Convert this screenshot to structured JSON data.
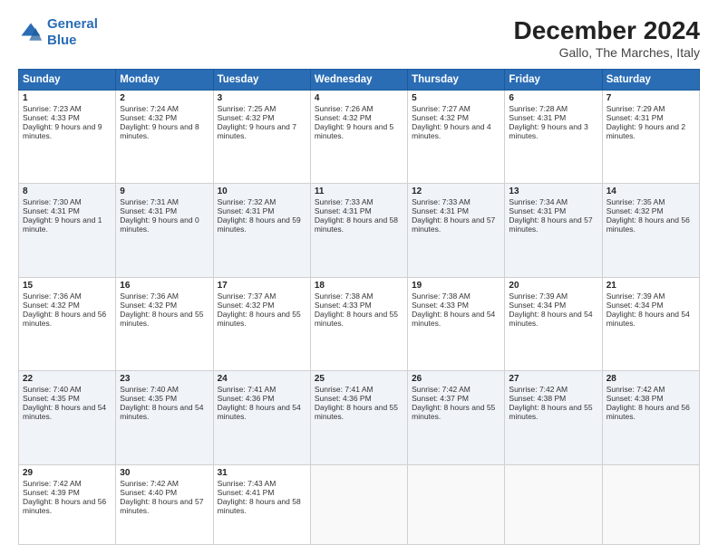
{
  "header": {
    "logo_line1": "General",
    "logo_line2": "Blue",
    "title": "December 2024",
    "subtitle": "Gallo, The Marches, Italy"
  },
  "days_of_week": [
    "Sunday",
    "Monday",
    "Tuesday",
    "Wednesday",
    "Thursday",
    "Friday",
    "Saturday"
  ],
  "weeks": [
    [
      {
        "day": "1",
        "sunrise": "7:23 AM",
        "sunset": "4:33 PM",
        "daylight": "9 hours and 9 minutes."
      },
      {
        "day": "2",
        "sunrise": "7:24 AM",
        "sunset": "4:32 PM",
        "daylight": "9 hours and 8 minutes."
      },
      {
        "day": "3",
        "sunrise": "7:25 AM",
        "sunset": "4:32 PM",
        "daylight": "9 hours and 7 minutes."
      },
      {
        "day": "4",
        "sunrise": "7:26 AM",
        "sunset": "4:32 PM",
        "daylight": "9 hours and 5 minutes."
      },
      {
        "day": "5",
        "sunrise": "7:27 AM",
        "sunset": "4:32 PM",
        "daylight": "9 hours and 4 minutes."
      },
      {
        "day": "6",
        "sunrise": "7:28 AM",
        "sunset": "4:31 PM",
        "daylight": "9 hours and 3 minutes."
      },
      {
        "day": "7",
        "sunrise": "7:29 AM",
        "sunset": "4:31 PM",
        "daylight": "9 hours and 2 minutes."
      }
    ],
    [
      {
        "day": "8",
        "sunrise": "7:30 AM",
        "sunset": "4:31 PM",
        "daylight": "9 hours and 1 minute."
      },
      {
        "day": "9",
        "sunrise": "7:31 AM",
        "sunset": "4:31 PM",
        "daylight": "9 hours and 0 minutes."
      },
      {
        "day": "10",
        "sunrise": "7:32 AM",
        "sunset": "4:31 PM",
        "daylight": "8 hours and 59 minutes."
      },
      {
        "day": "11",
        "sunrise": "7:33 AM",
        "sunset": "4:31 PM",
        "daylight": "8 hours and 58 minutes."
      },
      {
        "day": "12",
        "sunrise": "7:33 AM",
        "sunset": "4:31 PM",
        "daylight": "8 hours and 57 minutes."
      },
      {
        "day": "13",
        "sunrise": "7:34 AM",
        "sunset": "4:31 PM",
        "daylight": "8 hours and 57 minutes."
      },
      {
        "day": "14",
        "sunrise": "7:35 AM",
        "sunset": "4:32 PM",
        "daylight": "8 hours and 56 minutes."
      }
    ],
    [
      {
        "day": "15",
        "sunrise": "7:36 AM",
        "sunset": "4:32 PM",
        "daylight": "8 hours and 56 minutes."
      },
      {
        "day": "16",
        "sunrise": "7:36 AM",
        "sunset": "4:32 PM",
        "daylight": "8 hours and 55 minutes."
      },
      {
        "day": "17",
        "sunrise": "7:37 AM",
        "sunset": "4:32 PM",
        "daylight": "8 hours and 55 minutes."
      },
      {
        "day": "18",
        "sunrise": "7:38 AM",
        "sunset": "4:33 PM",
        "daylight": "8 hours and 55 minutes."
      },
      {
        "day": "19",
        "sunrise": "7:38 AM",
        "sunset": "4:33 PM",
        "daylight": "8 hours and 54 minutes."
      },
      {
        "day": "20",
        "sunrise": "7:39 AM",
        "sunset": "4:34 PM",
        "daylight": "8 hours and 54 minutes."
      },
      {
        "day": "21",
        "sunrise": "7:39 AM",
        "sunset": "4:34 PM",
        "daylight": "8 hours and 54 minutes."
      }
    ],
    [
      {
        "day": "22",
        "sunrise": "7:40 AM",
        "sunset": "4:35 PM",
        "daylight": "8 hours and 54 minutes."
      },
      {
        "day": "23",
        "sunrise": "7:40 AM",
        "sunset": "4:35 PM",
        "daylight": "8 hours and 54 minutes."
      },
      {
        "day": "24",
        "sunrise": "7:41 AM",
        "sunset": "4:36 PM",
        "daylight": "8 hours and 54 minutes."
      },
      {
        "day": "25",
        "sunrise": "7:41 AM",
        "sunset": "4:36 PM",
        "daylight": "8 hours and 55 minutes."
      },
      {
        "day": "26",
        "sunrise": "7:42 AM",
        "sunset": "4:37 PM",
        "daylight": "8 hours and 55 minutes."
      },
      {
        "day": "27",
        "sunrise": "7:42 AM",
        "sunset": "4:38 PM",
        "daylight": "8 hours and 55 minutes."
      },
      {
        "day": "28",
        "sunrise": "7:42 AM",
        "sunset": "4:38 PM",
        "daylight": "8 hours and 56 minutes."
      }
    ],
    [
      {
        "day": "29",
        "sunrise": "7:42 AM",
        "sunset": "4:39 PM",
        "daylight": "8 hours and 56 minutes."
      },
      {
        "day": "30",
        "sunrise": "7:42 AM",
        "sunset": "4:40 PM",
        "daylight": "8 hours and 57 minutes."
      },
      {
        "day": "31",
        "sunrise": "7:43 AM",
        "sunset": "4:41 PM",
        "daylight": "8 hours and 58 minutes."
      },
      null,
      null,
      null,
      null
    ]
  ],
  "labels": {
    "sunrise": "Sunrise:",
    "sunset": "Sunset:",
    "daylight": "Daylight:"
  }
}
